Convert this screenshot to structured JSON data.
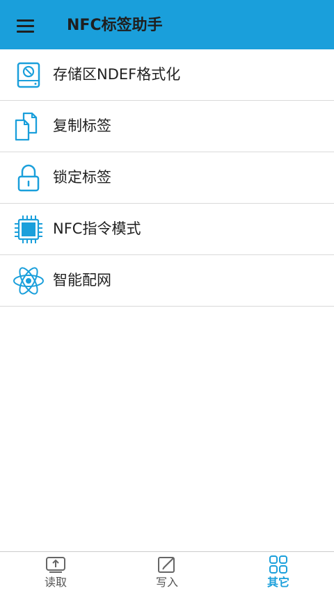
{
  "header": {
    "title": "NFC标签助手",
    "menu_icon": "hamburger-menu-icon",
    "background_color": "#1a9fdb"
  },
  "menu_items": [
    {
      "label": "存储区NDEF格式化",
      "icon": "disk-format-icon"
    },
    {
      "label": "复制标签",
      "icon": "copy-icon"
    },
    {
      "label": "锁定标签",
      "icon": "lock-icon"
    },
    {
      "label": "NFC指令模式",
      "icon": "chip-icon"
    },
    {
      "label": "智能配网",
      "icon": "atom-network-icon"
    }
  ],
  "tabs": [
    {
      "label": "读取",
      "icon": "read-tray-icon",
      "active": false
    },
    {
      "label": "写入",
      "icon": "write-edit-icon",
      "active": false
    },
    {
      "label": "其它",
      "icon": "grid-apps-icon",
      "active": true
    }
  ],
  "colors": {
    "accent": "#1a9fdb",
    "text": "#1f1f1f",
    "divider": "#d9d9d9"
  }
}
